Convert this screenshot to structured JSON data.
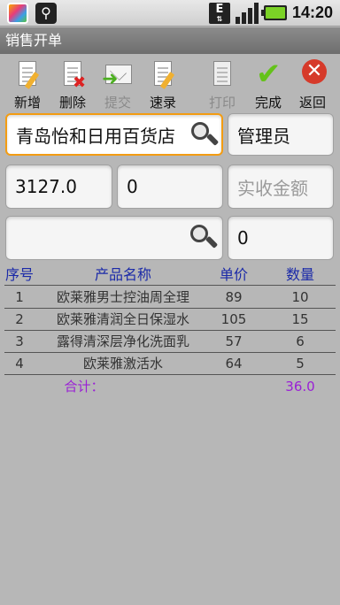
{
  "status_bar": {
    "icons": [
      "app-icon",
      "usb-icon",
      "edge-data-icon",
      "signal-icon",
      "battery-icon"
    ],
    "edge_label": "E",
    "time": "14:20"
  },
  "title": "销售开单",
  "toolbar": {
    "buttons": [
      {
        "label": "新增",
        "icon": "new-document-icon",
        "enabled": true
      },
      {
        "label": "删除",
        "icon": "delete-document-icon",
        "enabled": true
      },
      {
        "label": "提交",
        "icon": "submit-envelope-icon",
        "enabled": false
      },
      {
        "label": "速录",
        "icon": "quick-entry-icon",
        "enabled": true
      },
      {
        "label": "打印",
        "icon": "print-icon",
        "enabled": false
      },
      {
        "label": "完成",
        "icon": "checkmark-icon",
        "enabled": true
      },
      {
        "label": "返回",
        "icon": "back-x-icon",
        "enabled": true
      }
    ]
  },
  "form": {
    "customer_value": "青岛怡和日用百货店",
    "operator_value": "管理员",
    "amount_value": "3127.0",
    "discount_value": "0",
    "received_placeholder": "实收金额",
    "product_search_value": "",
    "quantity_value": "0"
  },
  "table": {
    "headers": [
      "序号",
      "产品名称",
      "单价",
      "数量"
    ],
    "rows": [
      {
        "no": "1",
        "name": "欧莱雅男士控油周全理",
        "price": "89",
        "qty": "10"
      },
      {
        "no": "2",
        "name": "欧莱雅清润全日保湿水",
        "price": "105",
        "qty": "15"
      },
      {
        "no": "3",
        "name": "露得清深层净化洗面乳",
        "price": "57",
        "qty": "6"
      },
      {
        "no": "4",
        "name": "欧莱雅激活水",
        "price": "64",
        "qty": "5"
      }
    ],
    "total_label": "合计：",
    "total_qty": "36.0"
  },
  "colors": {
    "header_text": "#1b2aa8",
    "total_text": "#9a1fd6",
    "focus_border": "#f39c12"
  }
}
